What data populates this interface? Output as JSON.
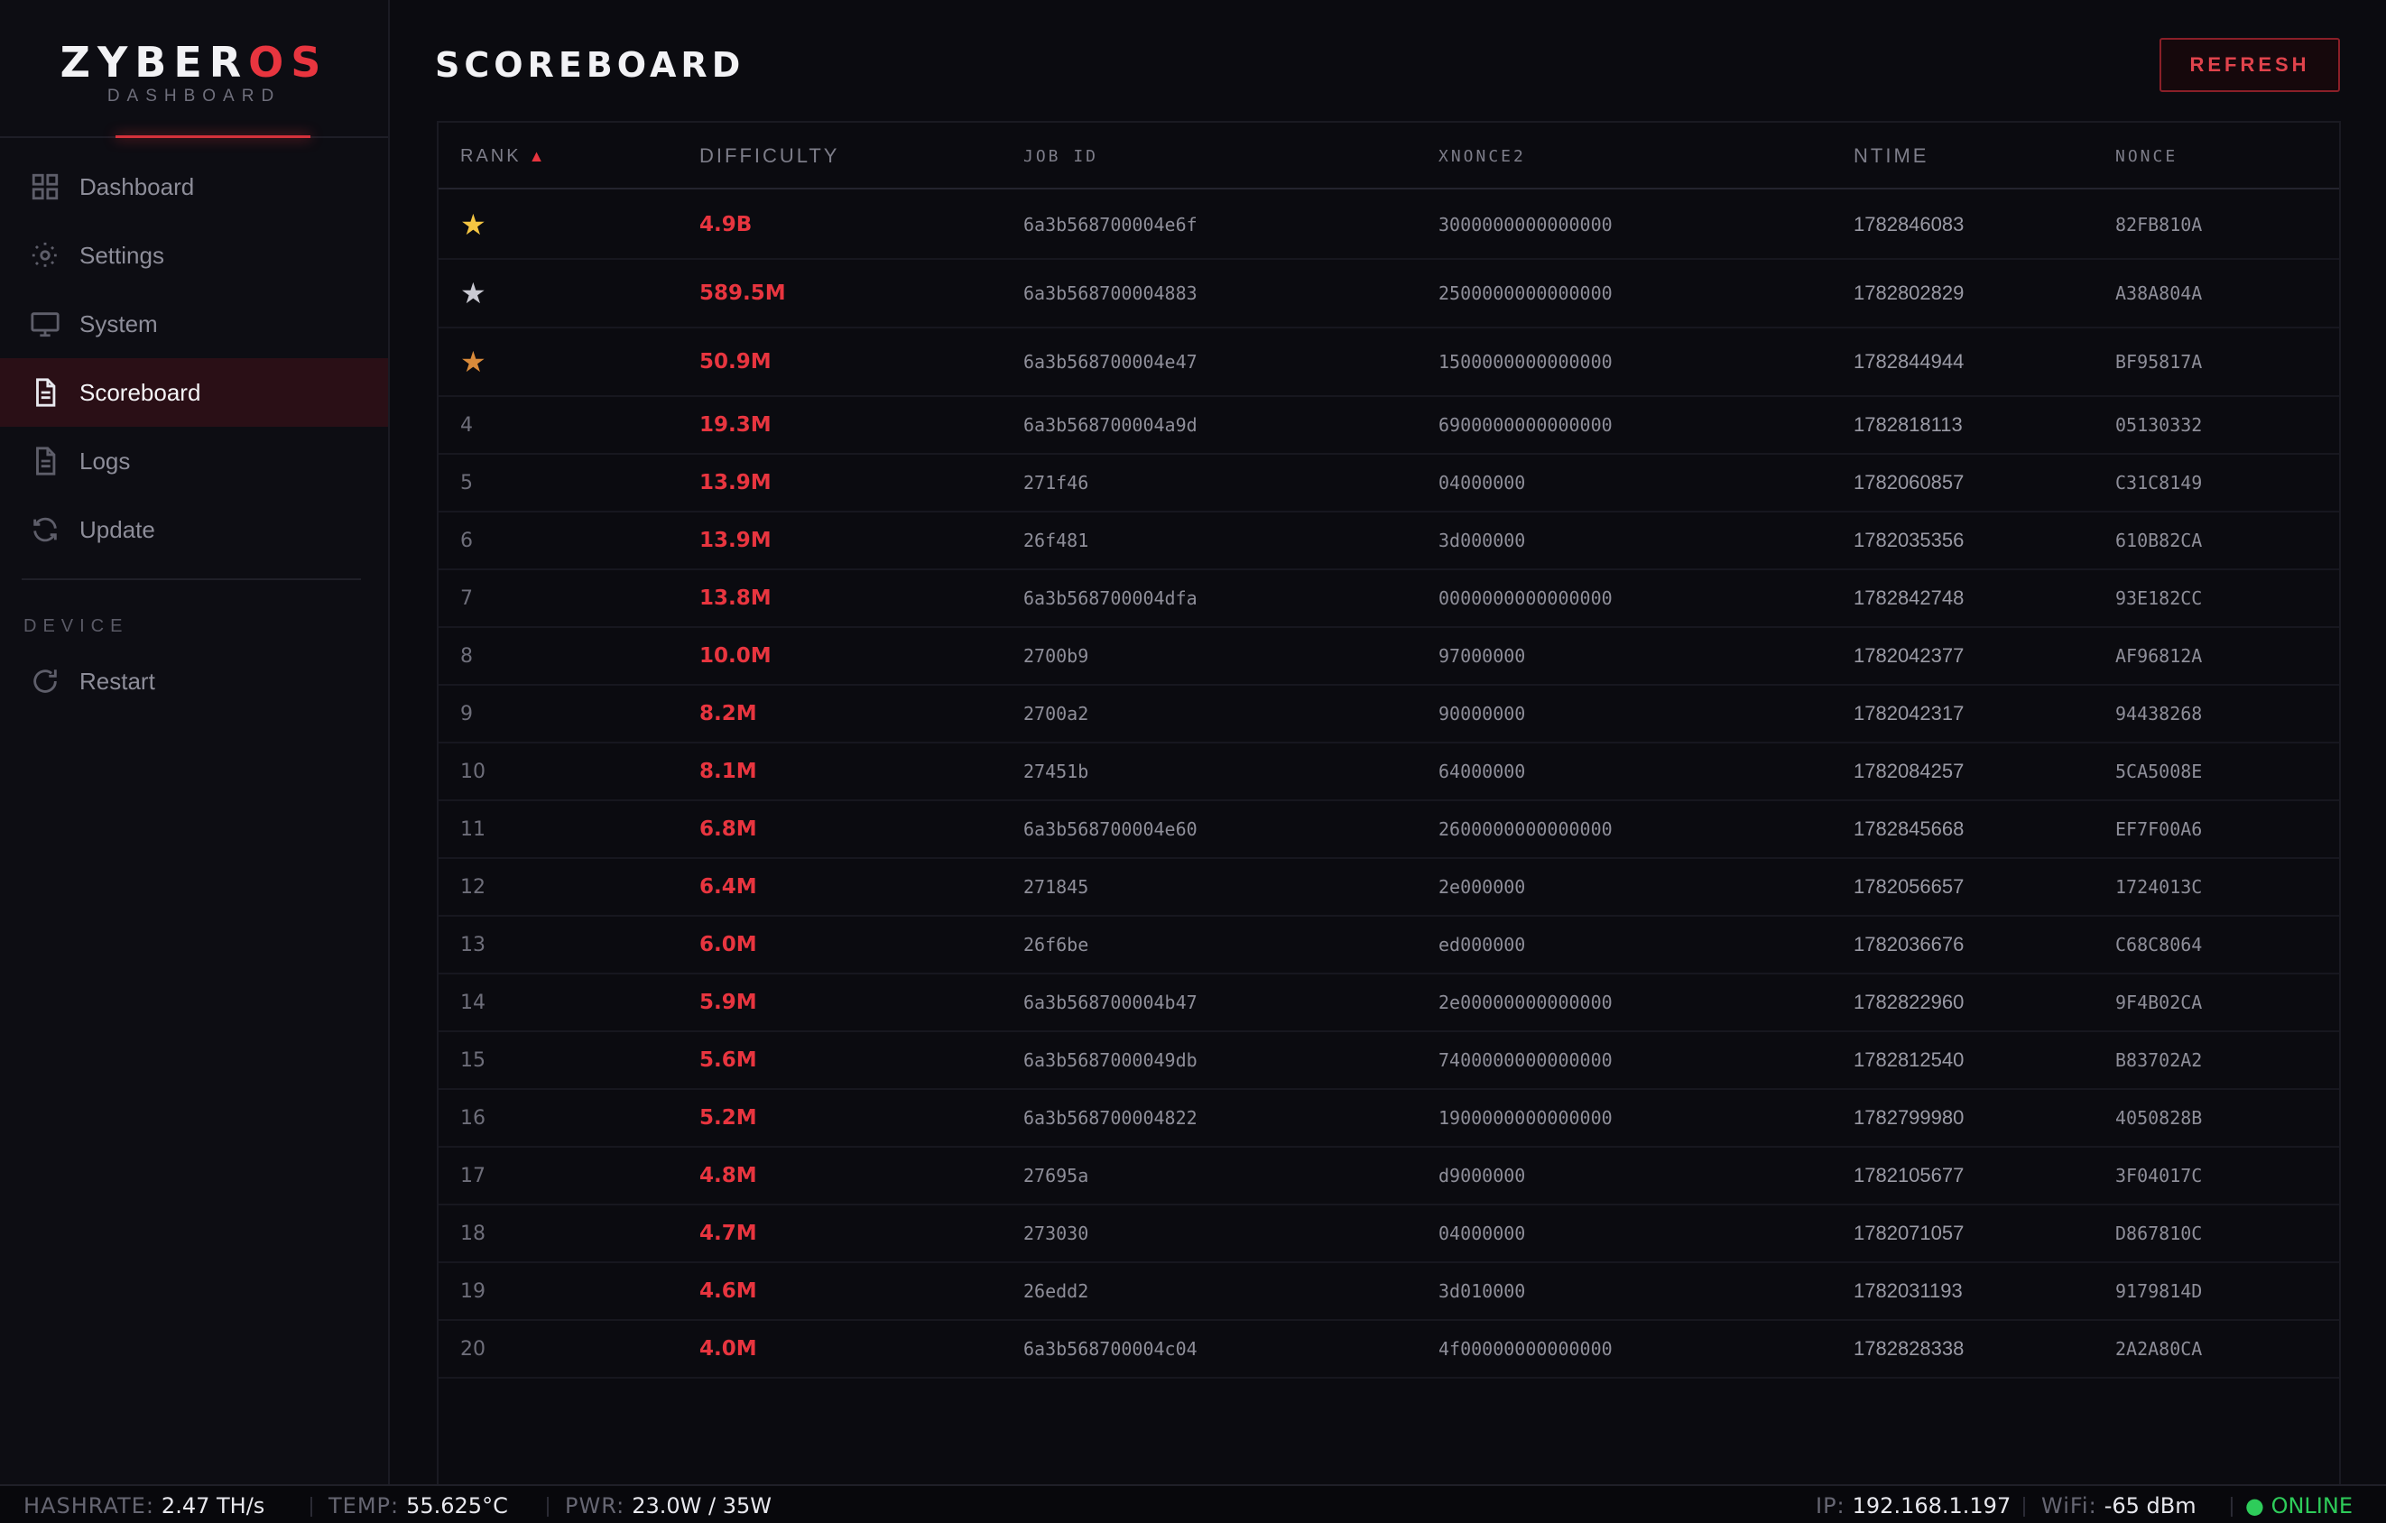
{
  "brand": {
    "name_main": "ZYBER",
    "name_accent": "OS",
    "subtitle": "DASHBOARD"
  },
  "sidebar": {
    "items": [
      {
        "label": "Dashboard",
        "icon": "grid-icon",
        "active": false
      },
      {
        "label": "Settings",
        "icon": "gear-icon",
        "active": false
      },
      {
        "label": "System",
        "icon": "monitor-icon",
        "active": false
      },
      {
        "label": "Scoreboard",
        "icon": "document-icon",
        "active": true
      },
      {
        "label": "Logs",
        "icon": "document-icon",
        "active": false
      },
      {
        "label": "Update",
        "icon": "refresh-icon",
        "active": false
      }
    ],
    "section_label": "DEVICE",
    "device_items": [
      {
        "label": "Restart",
        "icon": "restart-icon"
      }
    ]
  },
  "page": {
    "title": "SCOREBOARD",
    "refresh_label": "REFRESH"
  },
  "table": {
    "columns": [
      "RANK",
      "DIFFICULTY",
      "JOB ID",
      "XNONCE2",
      "NTIME",
      "NONCE"
    ],
    "sort_indicator": "▲",
    "rows": [
      {
        "rank": "1",
        "difficulty": "4.9B",
        "job_id": "6a3b568700004e6f",
        "xnonce2": "3000000000000000",
        "ntime": "1782846083",
        "nonce": "82FB810A"
      },
      {
        "rank": "2",
        "difficulty": "589.5M",
        "job_id": "6a3b568700004883",
        "xnonce2": "2500000000000000",
        "ntime": "1782802829",
        "nonce": "A38A804A"
      },
      {
        "rank": "3",
        "difficulty": "50.9M",
        "job_id": "6a3b568700004e47",
        "xnonce2": "1500000000000000",
        "ntime": "1782844944",
        "nonce": "BF95817A"
      },
      {
        "rank": "4",
        "difficulty": "19.3M",
        "job_id": "6a3b568700004a9d",
        "xnonce2": "6900000000000000",
        "ntime": "1782818113",
        "nonce": "05130332"
      },
      {
        "rank": "5",
        "difficulty": "13.9M",
        "job_id": "271f46",
        "xnonce2": "04000000",
        "ntime": "1782060857",
        "nonce": "C31C8149"
      },
      {
        "rank": "6",
        "difficulty": "13.9M",
        "job_id": "26f481",
        "xnonce2": "3d000000",
        "ntime": "1782035356",
        "nonce": "610B82CA"
      },
      {
        "rank": "7",
        "difficulty": "13.8M",
        "job_id": "6a3b568700004dfa",
        "xnonce2": "0000000000000000",
        "ntime": "1782842748",
        "nonce": "93E182CC"
      },
      {
        "rank": "8",
        "difficulty": "10.0M",
        "job_id": "2700b9",
        "xnonce2": "97000000",
        "ntime": "1782042377",
        "nonce": "AF96812A"
      },
      {
        "rank": "9",
        "difficulty": "8.2M",
        "job_id": "2700a2",
        "xnonce2": "90000000",
        "ntime": "1782042317",
        "nonce": "94438268"
      },
      {
        "rank": "10",
        "difficulty": "8.1M",
        "job_id": "27451b",
        "xnonce2": "64000000",
        "ntime": "1782084257",
        "nonce": "5CA5008E"
      },
      {
        "rank": "11",
        "difficulty": "6.8M",
        "job_id": "6a3b568700004e60",
        "xnonce2": "2600000000000000",
        "ntime": "1782845668",
        "nonce": "EF7F00A6"
      },
      {
        "rank": "12",
        "difficulty": "6.4M",
        "job_id": "271845",
        "xnonce2": "2e000000",
        "ntime": "1782056657",
        "nonce": "1724013C"
      },
      {
        "rank": "13",
        "difficulty": "6.0M",
        "job_id": "26f6be",
        "xnonce2": "ed000000",
        "ntime": "1782036676",
        "nonce": "C68C8064"
      },
      {
        "rank": "14",
        "difficulty": "5.9M",
        "job_id": "6a3b568700004b47",
        "xnonce2": "2e00000000000000",
        "ntime": "1782822960",
        "nonce": "9F4B02CA"
      },
      {
        "rank": "15",
        "difficulty": "5.6M",
        "job_id": "6a3b5687000049db",
        "xnonce2": "7400000000000000",
        "ntime": "1782812540",
        "nonce": "B83702A2"
      },
      {
        "rank": "16",
        "difficulty": "5.2M",
        "job_id": "6a3b568700004822",
        "xnonce2": "1900000000000000",
        "ntime": "1782799980",
        "nonce": "4050828B"
      },
      {
        "rank": "17",
        "difficulty": "4.8M",
        "job_id": "27695a",
        "xnonce2": "d9000000",
        "ntime": "1782105677",
        "nonce": "3F04017C"
      },
      {
        "rank": "18",
        "difficulty": "4.7M",
        "job_id": "273030",
        "xnonce2": "04000000",
        "ntime": "1782071057",
        "nonce": "D867810C"
      },
      {
        "rank": "19",
        "difficulty": "4.6M",
        "job_id": "26edd2",
        "xnonce2": "3d010000",
        "ntime": "1782031193",
        "nonce": "9179814D"
      },
      {
        "rank": "20",
        "difficulty": "4.0M",
        "job_id": "6a3b568700004c04",
        "xnonce2": "4f00000000000000",
        "ntime": "1782828338",
        "nonce": "2A2A80CA"
      }
    ],
    "star_colors": [
      "#f4c542",
      "#c9c9d2",
      "#d98a3a"
    ]
  },
  "statusbar": {
    "hashrate_label": "HASHRATE:",
    "hashrate_value": "2.47 TH/s",
    "temp_label": "TEMP:",
    "temp_value": "55.625°C",
    "pwr_label": "PWR:",
    "pwr_value": "23.0W / 35W",
    "ip_label": "IP:",
    "ip_value": "192.168.1.197",
    "wifi_label": "WiFi:",
    "wifi_value": "-65 dBm",
    "status": "● ONLINE"
  },
  "colors": {
    "accent": "#e8353f",
    "background": "#0b0b10",
    "online": "#2ecc5a"
  }
}
